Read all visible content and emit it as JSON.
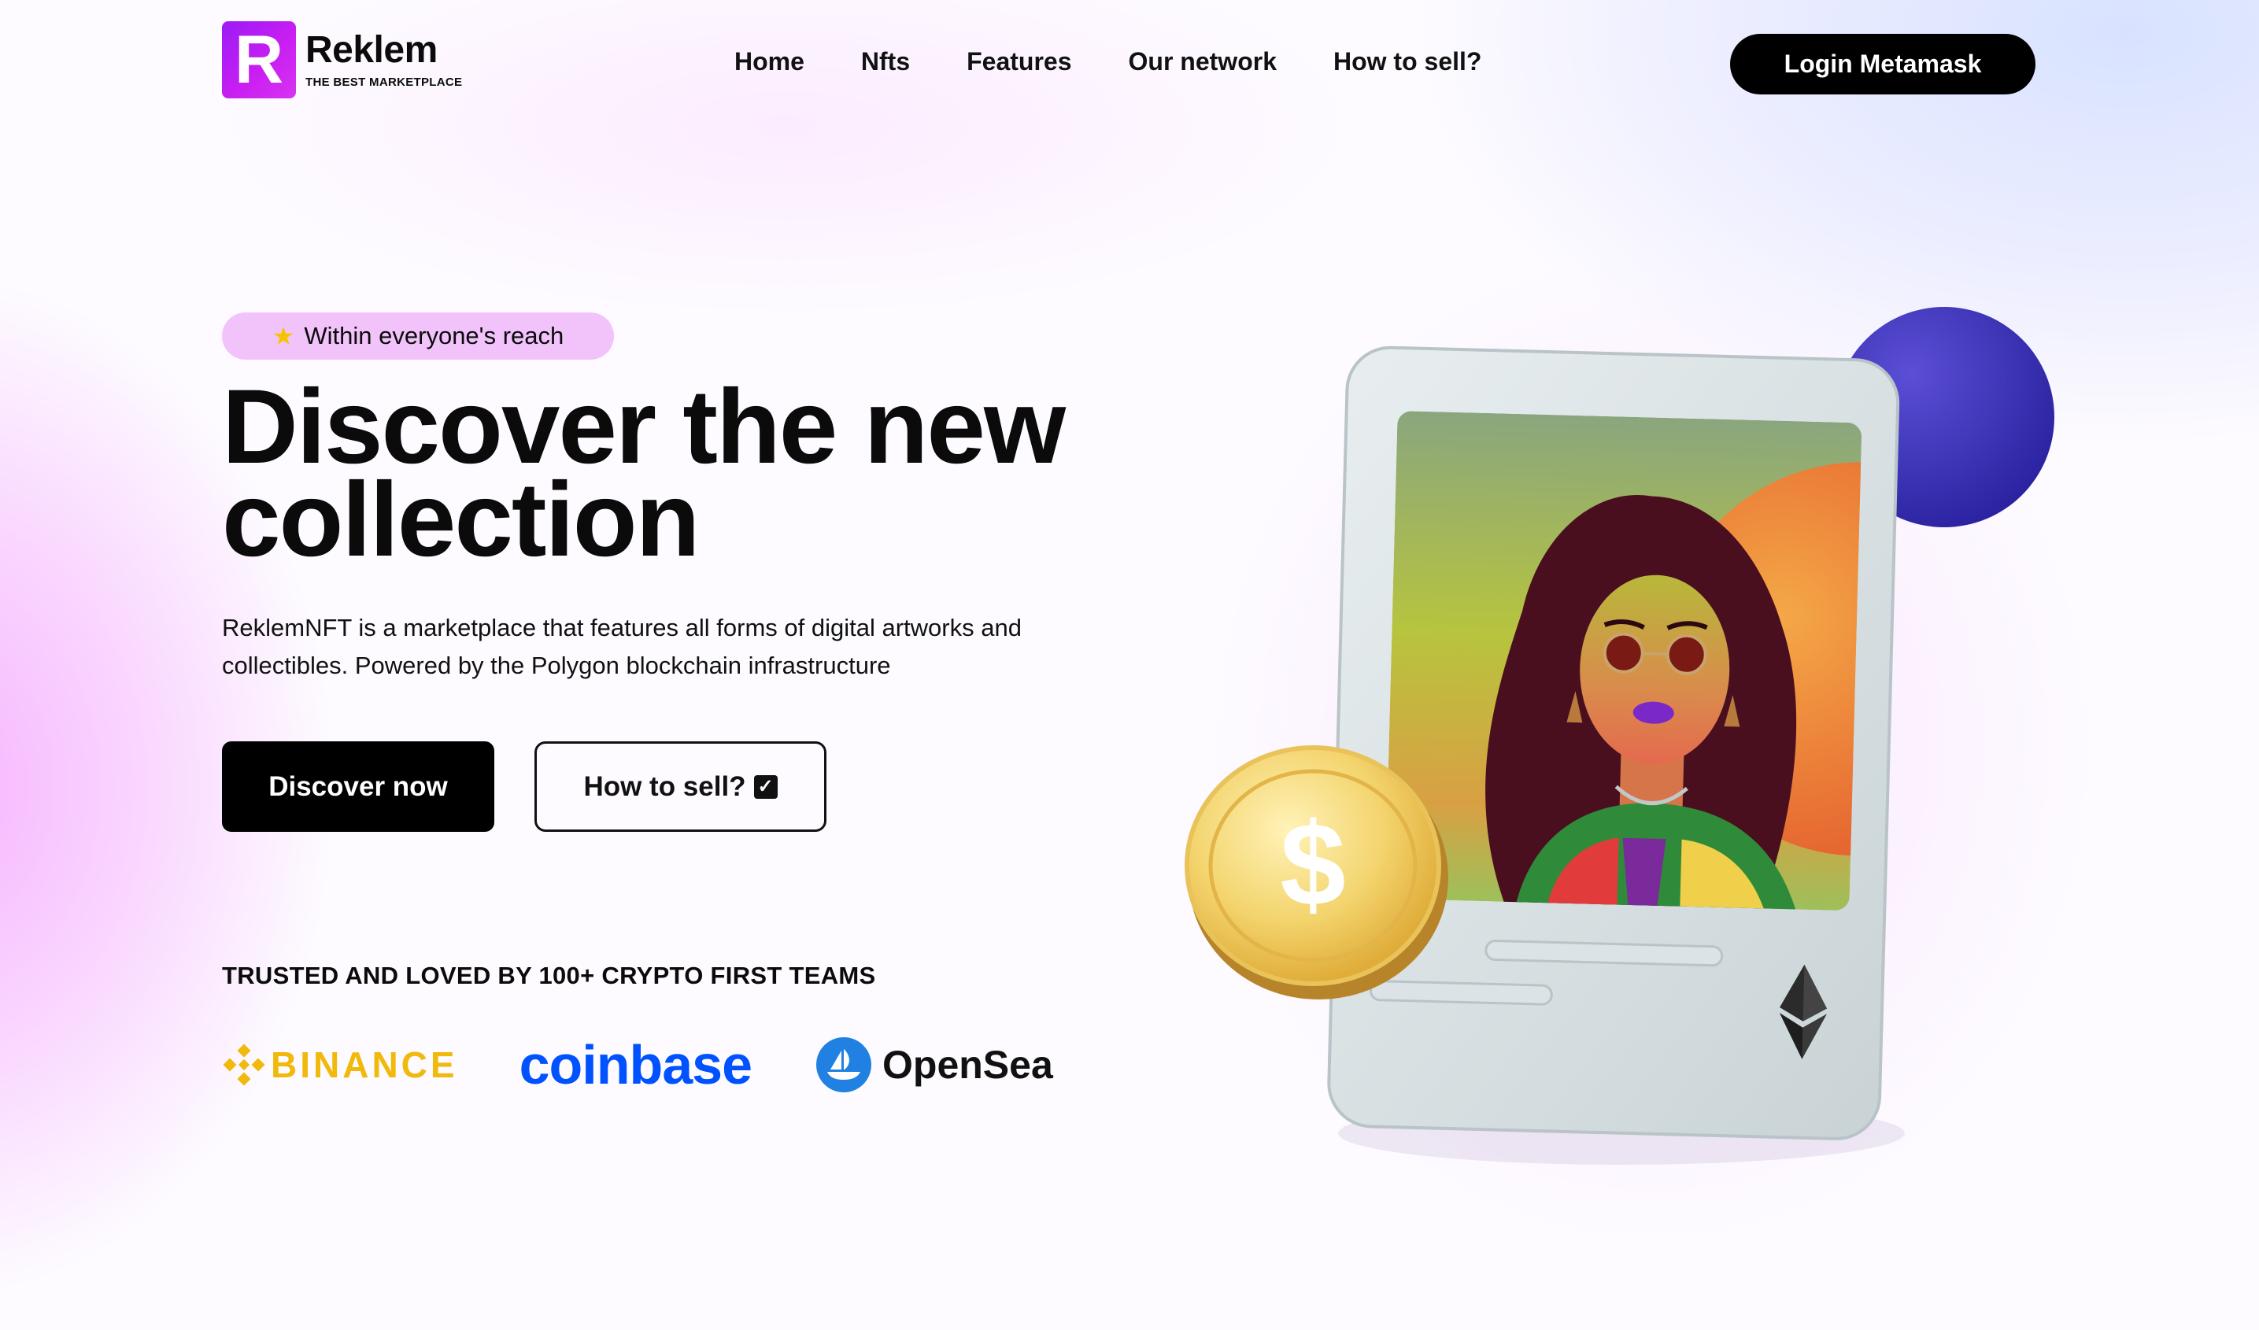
{
  "brand": {
    "logo_letter": "R",
    "name": "Reklem",
    "tagline": "THE BEST MARKETPLACE",
    "accent_color": "#c41df2"
  },
  "nav": {
    "items": [
      {
        "label": "Home"
      },
      {
        "label": "Nfts"
      },
      {
        "label": "Features"
      },
      {
        "label": "Our network"
      },
      {
        "label": "How to sell?"
      }
    ],
    "login_label": "Login Metamask"
  },
  "hero": {
    "badge_icon": "star-icon",
    "badge_text": "Within everyone's reach",
    "headline_line1": "Discover the new",
    "headline_line2": "collection",
    "description": "ReklemNFT is a marketplace that features all forms of digital artworks and collectibles. Powered by the Polygon blockchain infrastructure",
    "primary_cta": "Discover now",
    "secondary_cta": "How to sell?",
    "secondary_cta_icon": "checkbox-icon"
  },
  "trusted": {
    "heading": "TRUSTED AND LOVED BY 100+ CRYPTO FIRST TEAMS",
    "partners": [
      {
        "name": "BINANCE",
        "color": "#f0b90b",
        "icon": "binance-icon"
      },
      {
        "name": "coinbase",
        "color": "#0052ff"
      },
      {
        "name": "OpenSea",
        "color": "#2081e2",
        "icon": "opensea-icon"
      }
    ]
  },
  "illustration": {
    "coin_symbol": "$",
    "chain_icon": "ethereum-icon"
  }
}
